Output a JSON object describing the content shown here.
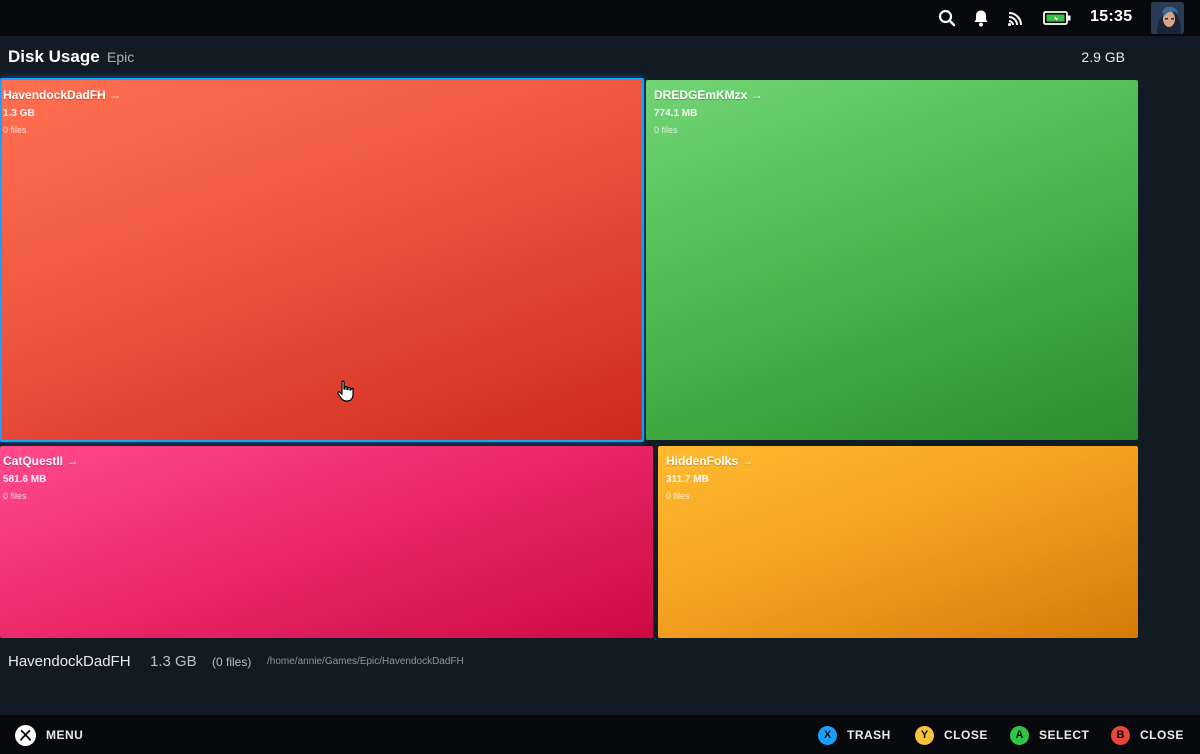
{
  "statusbar": {
    "icons": [
      "search-icon",
      "bell-icon",
      "cast-icon",
      "battery-icon"
    ],
    "time": "15:35"
  },
  "header": {
    "title": "Disk Usage",
    "subtitle": "Epic",
    "total": "2.9 GB"
  },
  "tiles": [
    {
      "name": "HavendockDadFH →",
      "size": "1.3 GB",
      "files": "0 files",
      "color": "#e84e3c",
      "selected": true
    },
    {
      "name": "DREDGEmKMzx →",
      "size": "774.1 MB",
      "files": "0 files",
      "color": "#4cb84f"
    },
    {
      "name": "CatQuestII →",
      "size": "581.6 MB",
      "files": "0 files",
      "color": "#ec2a6c"
    },
    {
      "name": "HiddenFolks →",
      "size": "311.7 MB",
      "files": "0 files",
      "color": "#f4a222"
    }
  ],
  "selection": {
    "name": "HavendockDadFH",
    "size": "1.3 GB",
    "files": "(0 files)",
    "path": "/home/annie/Games/Epic/HavendockDadFH"
  },
  "bottombar": {
    "menu_label": "MENU",
    "hints": [
      {
        "button": "X",
        "label": "TRASH",
        "color": "#1a9fff"
      },
      {
        "button": "Y",
        "label": "CLOSE",
        "color": "#f6c33a"
      },
      {
        "button": "A",
        "label": "SELECT",
        "color": "#2ec448"
      },
      {
        "button": "B",
        "label": "CLOSE",
        "color": "#e8463a"
      }
    ]
  }
}
